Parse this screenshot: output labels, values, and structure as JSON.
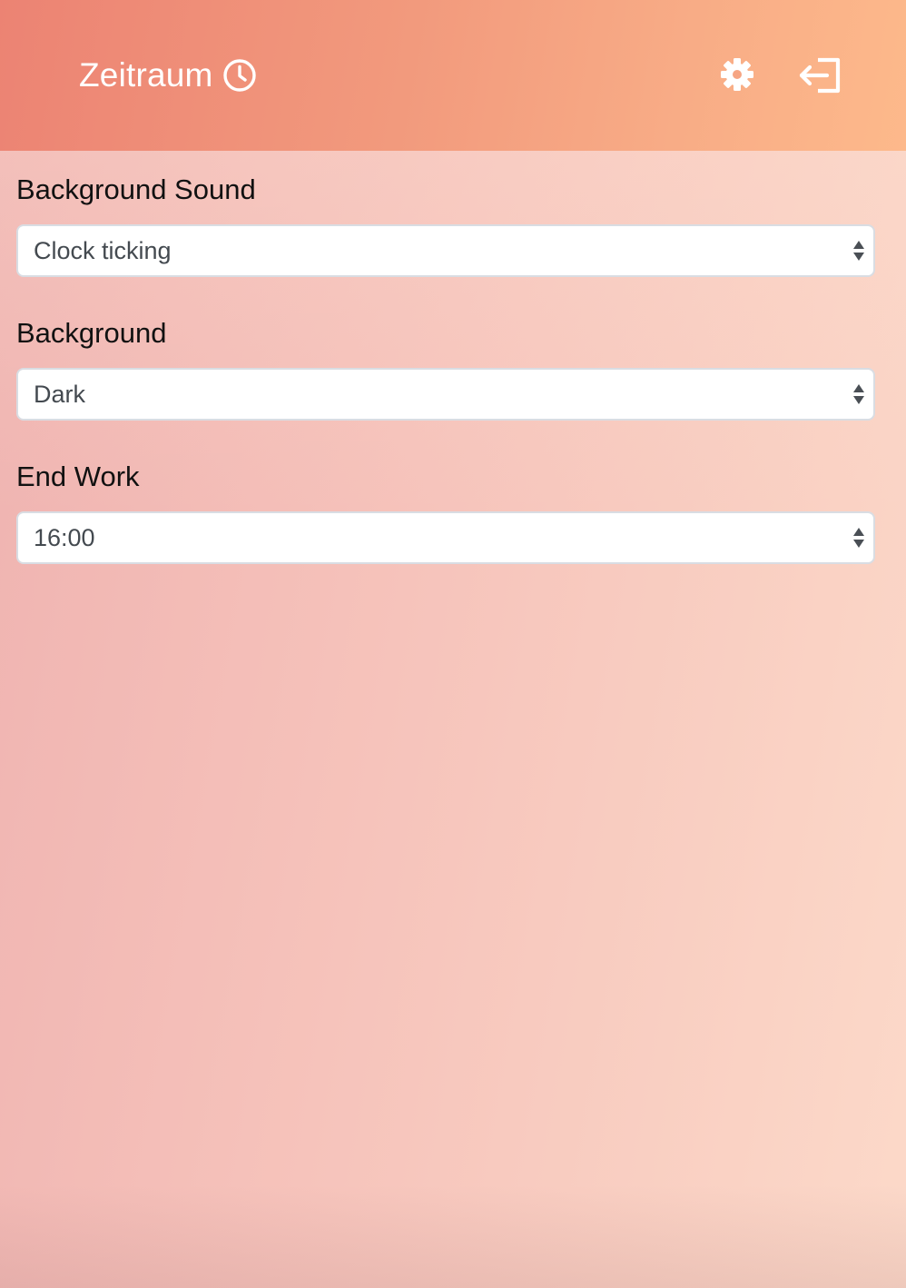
{
  "header": {
    "app_title": "Zeitraum",
    "icons": {
      "brand": "clock-icon",
      "settings": "gear-icon",
      "logout": "sign-out-icon"
    }
  },
  "settings": {
    "background_sound": {
      "label": "Background Sound",
      "value": "Clock ticking"
    },
    "background": {
      "label": "Background",
      "value": "Dark"
    },
    "end_work": {
      "label": "End Work",
      "value": "16:00"
    }
  },
  "colors": {
    "header_gradient_start": "#ec8373",
    "header_gradient_end": "#fdb98b",
    "page_background": "#f6c3bb",
    "select_background": "#ffffff",
    "select_text": "#444a50"
  }
}
